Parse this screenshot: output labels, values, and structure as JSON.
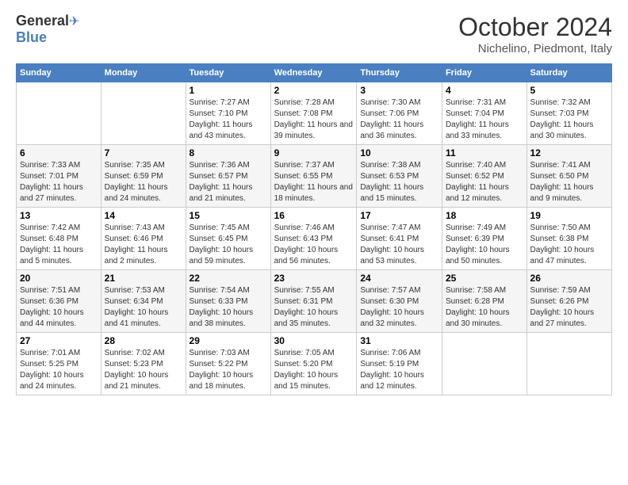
{
  "header": {
    "logo_general": "General",
    "logo_blue": "Blue",
    "title": "October 2024",
    "location": "Nichelino, Piedmont, Italy"
  },
  "calendar": {
    "days_of_week": [
      "Sunday",
      "Monday",
      "Tuesday",
      "Wednesday",
      "Thursday",
      "Friday",
      "Saturday"
    ],
    "weeks": [
      [
        {
          "day": "",
          "info": ""
        },
        {
          "day": "",
          "info": ""
        },
        {
          "day": "1",
          "info": "Sunrise: 7:27 AM\nSunset: 7:10 PM\nDaylight: 11 hours and 43 minutes."
        },
        {
          "day": "2",
          "info": "Sunrise: 7:28 AM\nSunset: 7:08 PM\nDaylight: 11 hours and 39 minutes."
        },
        {
          "day": "3",
          "info": "Sunrise: 7:30 AM\nSunset: 7:06 PM\nDaylight: 11 hours and 36 minutes."
        },
        {
          "day": "4",
          "info": "Sunrise: 7:31 AM\nSunset: 7:04 PM\nDaylight: 11 hours and 33 minutes."
        },
        {
          "day": "5",
          "info": "Sunrise: 7:32 AM\nSunset: 7:03 PM\nDaylight: 11 hours and 30 minutes."
        }
      ],
      [
        {
          "day": "6",
          "info": "Sunrise: 7:33 AM\nSunset: 7:01 PM\nDaylight: 11 hours and 27 minutes."
        },
        {
          "day": "7",
          "info": "Sunrise: 7:35 AM\nSunset: 6:59 PM\nDaylight: 11 hours and 24 minutes."
        },
        {
          "day": "8",
          "info": "Sunrise: 7:36 AM\nSunset: 6:57 PM\nDaylight: 11 hours and 21 minutes."
        },
        {
          "day": "9",
          "info": "Sunrise: 7:37 AM\nSunset: 6:55 PM\nDaylight: 11 hours and 18 minutes."
        },
        {
          "day": "10",
          "info": "Sunrise: 7:38 AM\nSunset: 6:53 PM\nDaylight: 11 hours and 15 minutes."
        },
        {
          "day": "11",
          "info": "Sunrise: 7:40 AM\nSunset: 6:52 PM\nDaylight: 11 hours and 12 minutes."
        },
        {
          "day": "12",
          "info": "Sunrise: 7:41 AM\nSunset: 6:50 PM\nDaylight: 11 hours and 9 minutes."
        }
      ],
      [
        {
          "day": "13",
          "info": "Sunrise: 7:42 AM\nSunset: 6:48 PM\nDaylight: 11 hours and 5 minutes."
        },
        {
          "day": "14",
          "info": "Sunrise: 7:43 AM\nSunset: 6:46 PM\nDaylight: 11 hours and 2 minutes."
        },
        {
          "day": "15",
          "info": "Sunrise: 7:45 AM\nSunset: 6:45 PM\nDaylight: 10 hours and 59 minutes."
        },
        {
          "day": "16",
          "info": "Sunrise: 7:46 AM\nSunset: 6:43 PM\nDaylight: 10 hours and 56 minutes."
        },
        {
          "day": "17",
          "info": "Sunrise: 7:47 AM\nSunset: 6:41 PM\nDaylight: 10 hours and 53 minutes."
        },
        {
          "day": "18",
          "info": "Sunrise: 7:49 AM\nSunset: 6:39 PM\nDaylight: 10 hours and 50 minutes."
        },
        {
          "day": "19",
          "info": "Sunrise: 7:50 AM\nSunset: 6:38 PM\nDaylight: 10 hours and 47 minutes."
        }
      ],
      [
        {
          "day": "20",
          "info": "Sunrise: 7:51 AM\nSunset: 6:36 PM\nDaylight: 10 hours and 44 minutes."
        },
        {
          "day": "21",
          "info": "Sunrise: 7:53 AM\nSunset: 6:34 PM\nDaylight: 10 hours and 41 minutes."
        },
        {
          "day": "22",
          "info": "Sunrise: 7:54 AM\nSunset: 6:33 PM\nDaylight: 10 hours and 38 minutes."
        },
        {
          "day": "23",
          "info": "Sunrise: 7:55 AM\nSunset: 6:31 PM\nDaylight: 10 hours and 35 minutes."
        },
        {
          "day": "24",
          "info": "Sunrise: 7:57 AM\nSunset: 6:30 PM\nDaylight: 10 hours and 32 minutes."
        },
        {
          "day": "25",
          "info": "Sunrise: 7:58 AM\nSunset: 6:28 PM\nDaylight: 10 hours and 30 minutes."
        },
        {
          "day": "26",
          "info": "Sunrise: 7:59 AM\nSunset: 6:26 PM\nDaylight: 10 hours and 27 minutes."
        }
      ],
      [
        {
          "day": "27",
          "info": "Sunrise: 7:01 AM\nSunset: 5:25 PM\nDaylight: 10 hours and 24 minutes."
        },
        {
          "day": "28",
          "info": "Sunrise: 7:02 AM\nSunset: 5:23 PM\nDaylight: 10 hours and 21 minutes."
        },
        {
          "day": "29",
          "info": "Sunrise: 7:03 AM\nSunset: 5:22 PM\nDaylight: 10 hours and 18 minutes."
        },
        {
          "day": "30",
          "info": "Sunrise: 7:05 AM\nSunset: 5:20 PM\nDaylight: 10 hours and 15 minutes."
        },
        {
          "day": "31",
          "info": "Sunrise: 7:06 AM\nSunset: 5:19 PM\nDaylight: 10 hours and 12 minutes."
        },
        {
          "day": "",
          "info": ""
        },
        {
          "day": "",
          "info": ""
        }
      ]
    ]
  }
}
